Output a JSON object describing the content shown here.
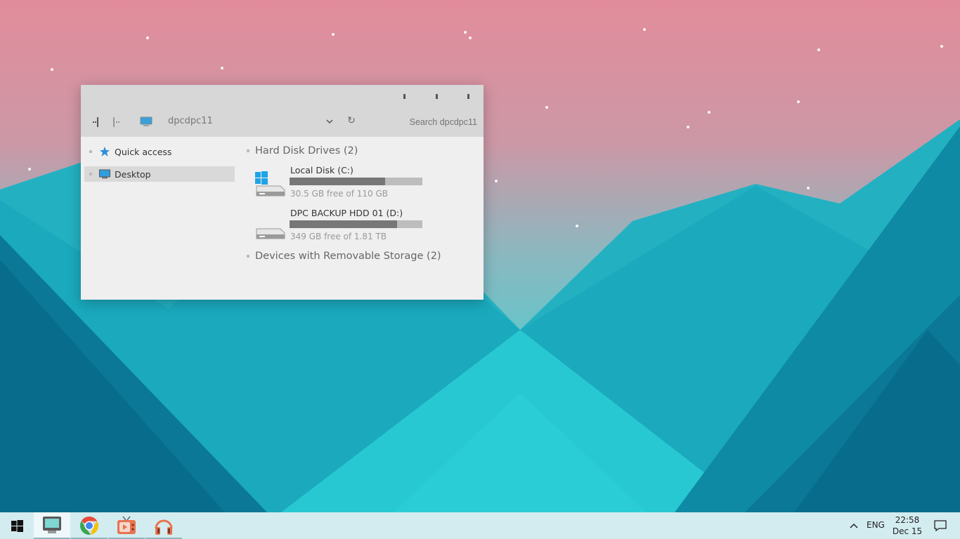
{
  "window": {
    "address": "dpcdpc11",
    "search_placeholder": "Search dpcdpc11"
  },
  "nav": {
    "items": [
      {
        "label": "Quick access",
        "icon": "star-icon"
      },
      {
        "label": "Desktop",
        "icon": "desktop-icon",
        "selected": true
      }
    ]
  },
  "content": {
    "groups": [
      {
        "title": "Hard Disk Drives (2)",
        "drives": [
          {
            "name": "Local Disk (C:)",
            "free": "30.5 GB free of 110 GB",
            "used_fraction": 0.72,
            "icon": "windows-drive-icon"
          },
          {
            "name": "DPC BACKUP HDD 01 (D:)",
            "free": "349 GB free of 1.81 TB",
            "used_fraction": 0.81,
            "icon": "hard-drive-icon"
          }
        ]
      },
      {
        "title": "Devices with Removable Storage (2)"
      }
    ]
  },
  "taskbar": {
    "apps": [
      "file-explorer-icon",
      "chrome-icon",
      "media-player-icon",
      "headphones-icon"
    ],
    "tray": {
      "language": "ENG",
      "time": "22:58",
      "date": "Dec 15"
    }
  },
  "colors": {
    "sky_top": "#e28c9b",
    "sky_bottom": "#5cc9cc",
    "mountain_dark": "#0a7896",
    "mountain_light": "#22c4d0",
    "taskbar": "#d3ecf0",
    "window_bg": "#efefef",
    "toolbar_bg": "#d7d7d7"
  }
}
